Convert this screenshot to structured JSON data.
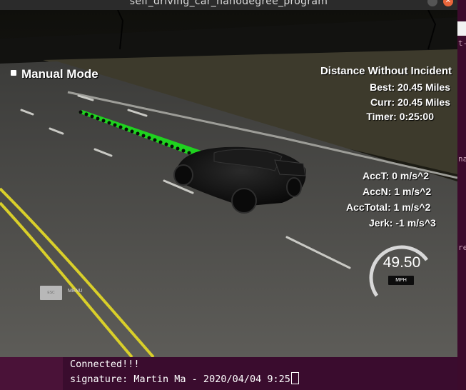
{
  "window": {
    "title": "self_driving_car_nanodegree_program"
  },
  "hud": {
    "mode": "Manual Mode",
    "distance_title": "Distance Without Incident",
    "best": "Best: 20.45 Miles",
    "curr": "Curr: 20.45 Miles",
    "timer": "Timer: 0:25:00",
    "acc_t": "AccT: 0 m/s^2",
    "acc_n": "AccN: 1 m/s^2",
    "acc_total": "AccTotal: 1 m/s^2",
    "jerk": "Jerk: -1 m/s^3",
    "speed": "49.50",
    "speed_unit": "MPH",
    "esc_label": "ESC",
    "menu_label": "MENU"
  },
  "terminal": {
    "line1": "Connected!!!",
    "line2": "signature: Martin Ma - 2020/04/04 9:25"
  },
  "side_terminal": {
    "fragments": [
      "t-",
      "na",
      "re"
    ]
  },
  "colors": {
    "path": "#1fd21f",
    "lane_yellow": "#d9cf2a",
    "terminal_bg": "#3a0c2e"
  }
}
